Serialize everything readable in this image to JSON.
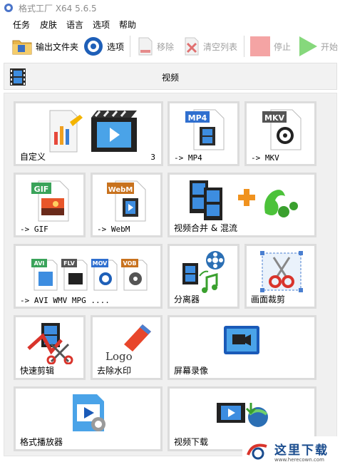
{
  "window": {
    "title": "格式工厂 X64 5.6.5"
  },
  "menu": [
    "任务",
    "皮肤",
    "语言",
    "选项",
    "帮助"
  ],
  "toolbar": {
    "output_folder": "输出文件夹",
    "options": "选项",
    "remove": "移除",
    "clear_list": "清空列表",
    "stop": "停止",
    "start": "开始"
  },
  "section": {
    "title": "视频"
  },
  "tiles": {
    "custom": {
      "label": "自定义",
      "count": "3"
    },
    "mp4": {
      "label": "-> MP4",
      "badge": "MP4"
    },
    "mkv": {
      "label": "-> MKV",
      "badge": "MKV"
    },
    "gif": {
      "label": "-> GIF",
      "badge": "GIF"
    },
    "webm": {
      "label": "-> WebM",
      "badge": "WebM"
    },
    "merge": {
      "label": "视频合并 & 混流"
    },
    "avi": {
      "label": "-> AVI WMV MPG ....",
      "badges": [
        "AVI",
        "FLV",
        "MOV",
        "VOB"
      ]
    },
    "splitter": {
      "label": "分离器"
    },
    "crop": {
      "label": "画面裁剪"
    },
    "quickcut": {
      "label": "快速剪辑"
    },
    "watermark": {
      "label": "去除水印",
      "logo": "Logo"
    },
    "screenrec": {
      "label": "屏幕录像"
    },
    "player": {
      "label": "格式播放器"
    },
    "download": {
      "label": "视频下载"
    }
  },
  "watermark_site": {
    "text": "这里下载",
    "url": "www.herecown.com"
  },
  "colors": {
    "accent_blue": "#1e6fd1",
    "stop_red": "#f4a4a4",
    "start_green": "#86d87c",
    "tile_border": "#dcdcdc"
  }
}
